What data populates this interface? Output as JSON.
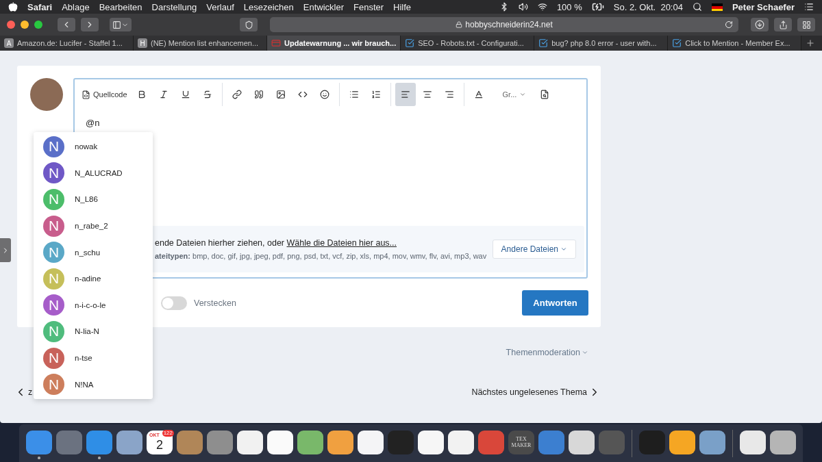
{
  "menu_bar": {
    "app": "Safari",
    "items": [
      "Ablage",
      "Bearbeiten",
      "Darstellung",
      "Verlauf",
      "Lesezeichen",
      "Entwickler",
      "Fenster",
      "Hilfe"
    ],
    "battery": "100 %",
    "clock": "So. 2. Okt.  20:04",
    "user": "Peter Schaefer"
  },
  "toolbar": {
    "url": "hobbyschneiderin24.net"
  },
  "tabs": [
    {
      "label": "Amazon.de: Lucifer - Staffel 1...",
      "kind": "letter",
      "letter": "A",
      "selected": false
    },
    {
      "label": "(NE) Mention list enhancemen...",
      "kind": "letter",
      "letter": "H",
      "selected": false
    },
    {
      "label": "Updatewarnung ... wir brauch...",
      "kind": "logo",
      "selected": true
    },
    {
      "label": "SEO - Robots.txt - Configurati...",
      "kind": "check",
      "selected": false
    },
    {
      "label": "bug? php 8.0 error - user with...",
      "kind": "check",
      "selected": false
    },
    {
      "label": "Click to Mention - Member Ex...",
      "kind": "check",
      "selected": false
    }
  ],
  "editor": {
    "source_label": "Quellcode",
    "font_label": "Gr...",
    "align": [
      {
        "selected": true
      },
      {
        "selected": false
      },
      {
        "selected": false
      }
    ],
    "content": "@n"
  },
  "mentions": [
    {
      "name": "nowak",
      "initial": "N",
      "color": "#5a6fc8"
    },
    {
      "name": "N_ALUCRAD",
      "initial": "N",
      "color": "#6f58c6"
    },
    {
      "name": "N_L86",
      "initial": "N",
      "color": "#4cbd6a"
    },
    {
      "name": "n_rabe_2",
      "initial": "N",
      "color": "#c85d8c"
    },
    {
      "name": "n_schu",
      "initial": "N",
      "color": "#5aa8c7"
    },
    {
      "name": "n-adine",
      "initial": "N",
      "color": "#c5bf5a"
    },
    {
      "name": "n-i-c-o-le",
      "initial": "N",
      "color": "#a65dc9"
    },
    {
      "name": "N-lia-N",
      "initial": "N",
      "color": "#4fbc7d"
    },
    {
      "name": "n-tse",
      "initial": "N",
      "color": "#c8625a"
    },
    {
      "name": "N!NA",
      "initial": "N",
      "color": "#cd7e5c"
    }
  ],
  "dropzone": {
    "text": "ende Dateien hierher ziehen, oder ",
    "link": "Wähle die Dateien hier aus...",
    "types_label": "ateitypen:",
    "types": "bmp, doc, gif, jpg, jpeg, pdf, png, psd, txt, vcf, zip, xls, mp4, mov, wmv, flv, avi, mp3, wav",
    "button": "Andere Dateien"
  },
  "options": {
    "hide_label": "Verstecken",
    "hide_on": false,
    "submit": "Antworten"
  },
  "moderation": "Themenmoderation",
  "nav": {
    "prev": "z",
    "next": "Nächstes ungelesenes Thema"
  },
  "dock": [
    {
      "kind": "app",
      "color": "#3b8fe8",
      "running": true
    },
    {
      "kind": "app",
      "color": "#6b7280",
      "running": false
    },
    {
      "kind": "app",
      "color": "#2f8ee6",
      "running": true
    },
    {
      "kind": "app",
      "color": "#8aa4c8",
      "running": false
    },
    {
      "kind": "calendar",
      "month": "OKT",
      "day": "2",
      "badge": "122",
      "running": false
    },
    {
      "kind": "app",
      "color": "#b08658",
      "running": false
    },
    {
      "kind": "app",
      "color": "#8e8e8e",
      "running": false
    },
    {
      "kind": "app",
      "color": "#f1f1f1",
      "running": false
    },
    {
      "kind": "app",
      "color": "#fafafa",
      "running": false
    },
    {
      "kind": "app",
      "color": "#79b86a",
      "running": false
    },
    {
      "kind": "app",
      "color": "#f0a040",
      "running": false
    },
    {
      "kind": "app",
      "color": "#f4f4f6",
      "running": false
    },
    {
      "kind": "app",
      "color": "#222222",
      "running": false
    },
    {
      "kind": "app",
      "color": "#f6f6f6",
      "running": false
    },
    {
      "kind": "app",
      "color": "#f2f2f2",
      "running": false
    },
    {
      "kind": "app",
      "color": "#d9473a",
      "running": false
    },
    {
      "kind": "label",
      "label": "TEX MAKER",
      "running": false
    },
    {
      "kind": "app",
      "color": "#3c7fd0",
      "running": false
    },
    {
      "kind": "app",
      "color": "#d8d8d8",
      "running": false
    },
    {
      "kind": "app",
      "color": "#555555",
      "running": false
    },
    {
      "kind": "divider"
    },
    {
      "kind": "app",
      "color": "#1e1e1e",
      "running": false
    },
    {
      "kind": "app",
      "color": "#f5a623",
      "running": false
    },
    {
      "kind": "app",
      "color": "#7aa0c8",
      "running": false
    },
    {
      "kind": "divider"
    },
    {
      "kind": "app",
      "color": "#e8e8e8",
      "running": false
    },
    {
      "kind": "app",
      "color": "#b5b5b5",
      "running": false
    }
  ]
}
